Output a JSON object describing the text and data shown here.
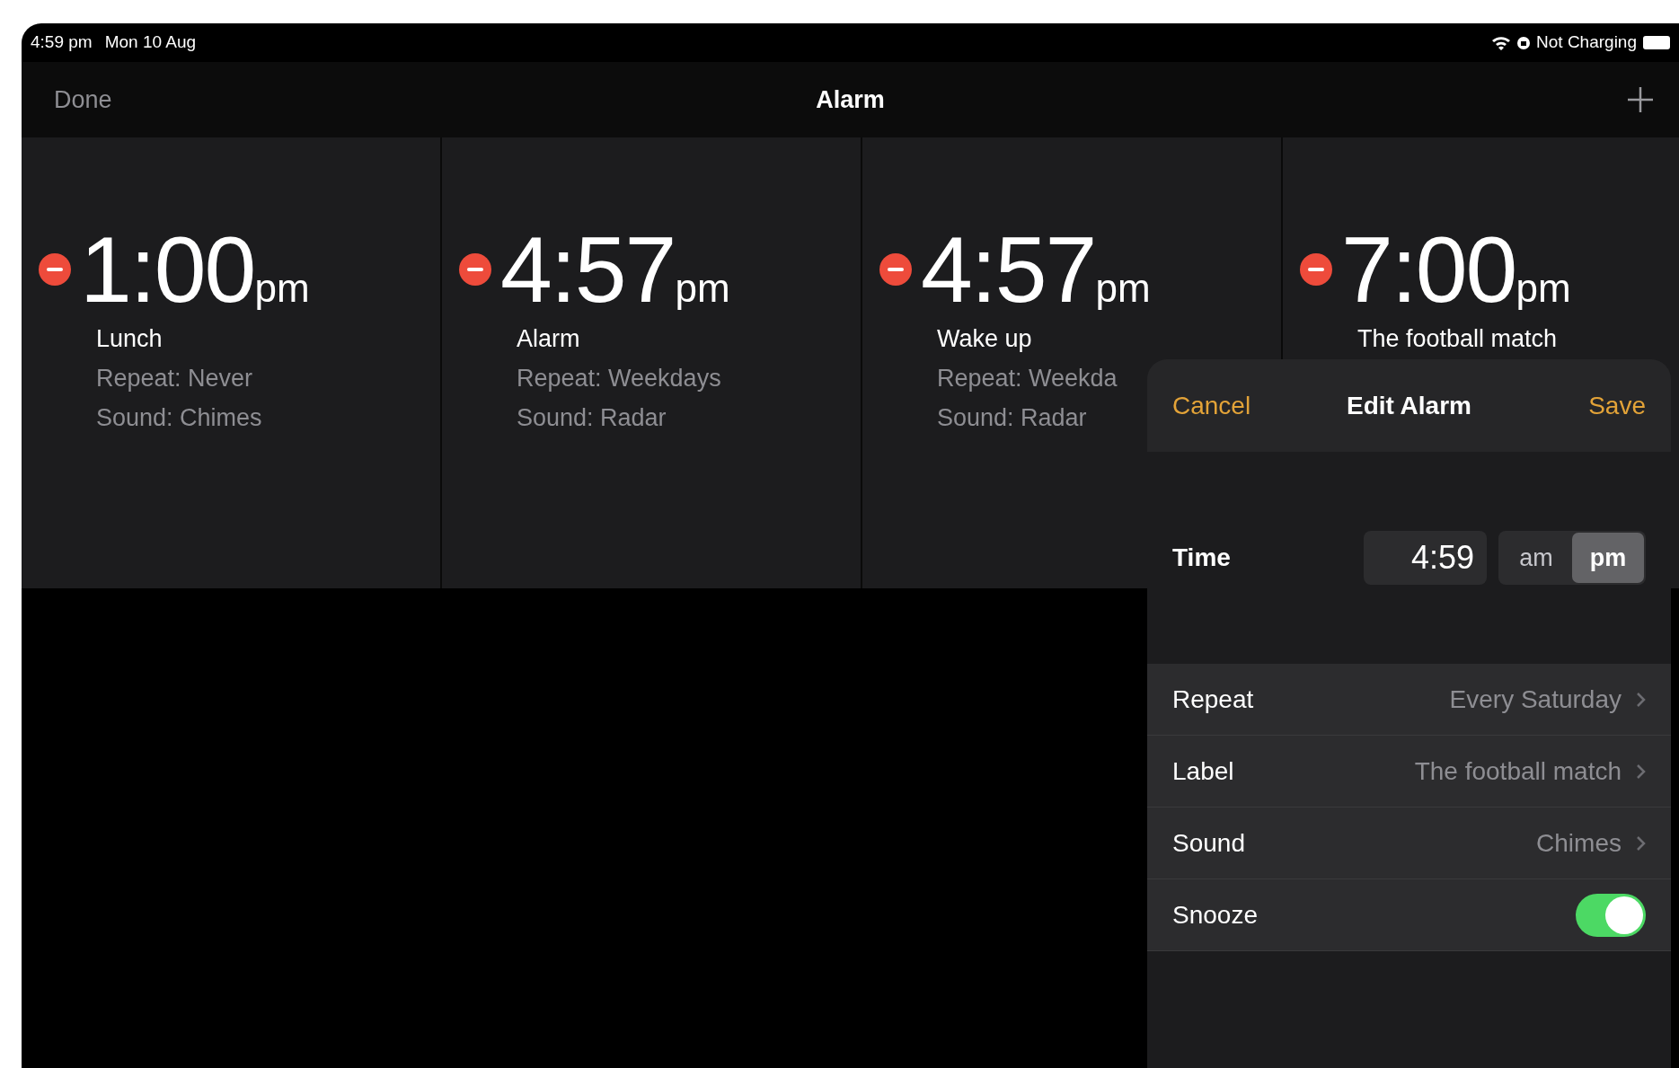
{
  "status_bar": {
    "time": "4:59 pm",
    "date": "Mon 10 Aug",
    "charging_text": "Not Charging"
  },
  "nav": {
    "left_button": "Done",
    "title": "Alarm"
  },
  "alarms": [
    {
      "time": "1:00",
      "period": "pm",
      "label": "Lunch",
      "repeat": "Repeat: Never",
      "sound": "Sound: Chimes"
    },
    {
      "time": "4:57",
      "period": "pm",
      "label": "Alarm",
      "repeat": "Repeat: Weekdays",
      "sound": "Sound: Radar"
    },
    {
      "time": "4:57",
      "period": "pm",
      "label": "Wake up",
      "repeat": "Repeat: Weekda",
      "sound": "Sound: Radar"
    },
    {
      "time": "7:00",
      "period": "pm",
      "label": "The football match"
    }
  ],
  "edit_alarm": {
    "cancel": "Cancel",
    "title": "Edit Alarm",
    "save": "Save",
    "time_label": "Time",
    "time_value": "4:59",
    "periods": [
      {
        "label": "am",
        "selected": false
      },
      {
        "label": "pm",
        "selected": true
      }
    ],
    "rows": [
      {
        "kind": "link",
        "label": "Repeat",
        "value": "Every Saturday"
      },
      {
        "kind": "link",
        "label": "Label",
        "value": "The football match"
      },
      {
        "kind": "link",
        "label": "Sound",
        "value": "Chimes"
      },
      {
        "kind": "toggle",
        "label": "Snooze",
        "on": true
      }
    ]
  }
}
